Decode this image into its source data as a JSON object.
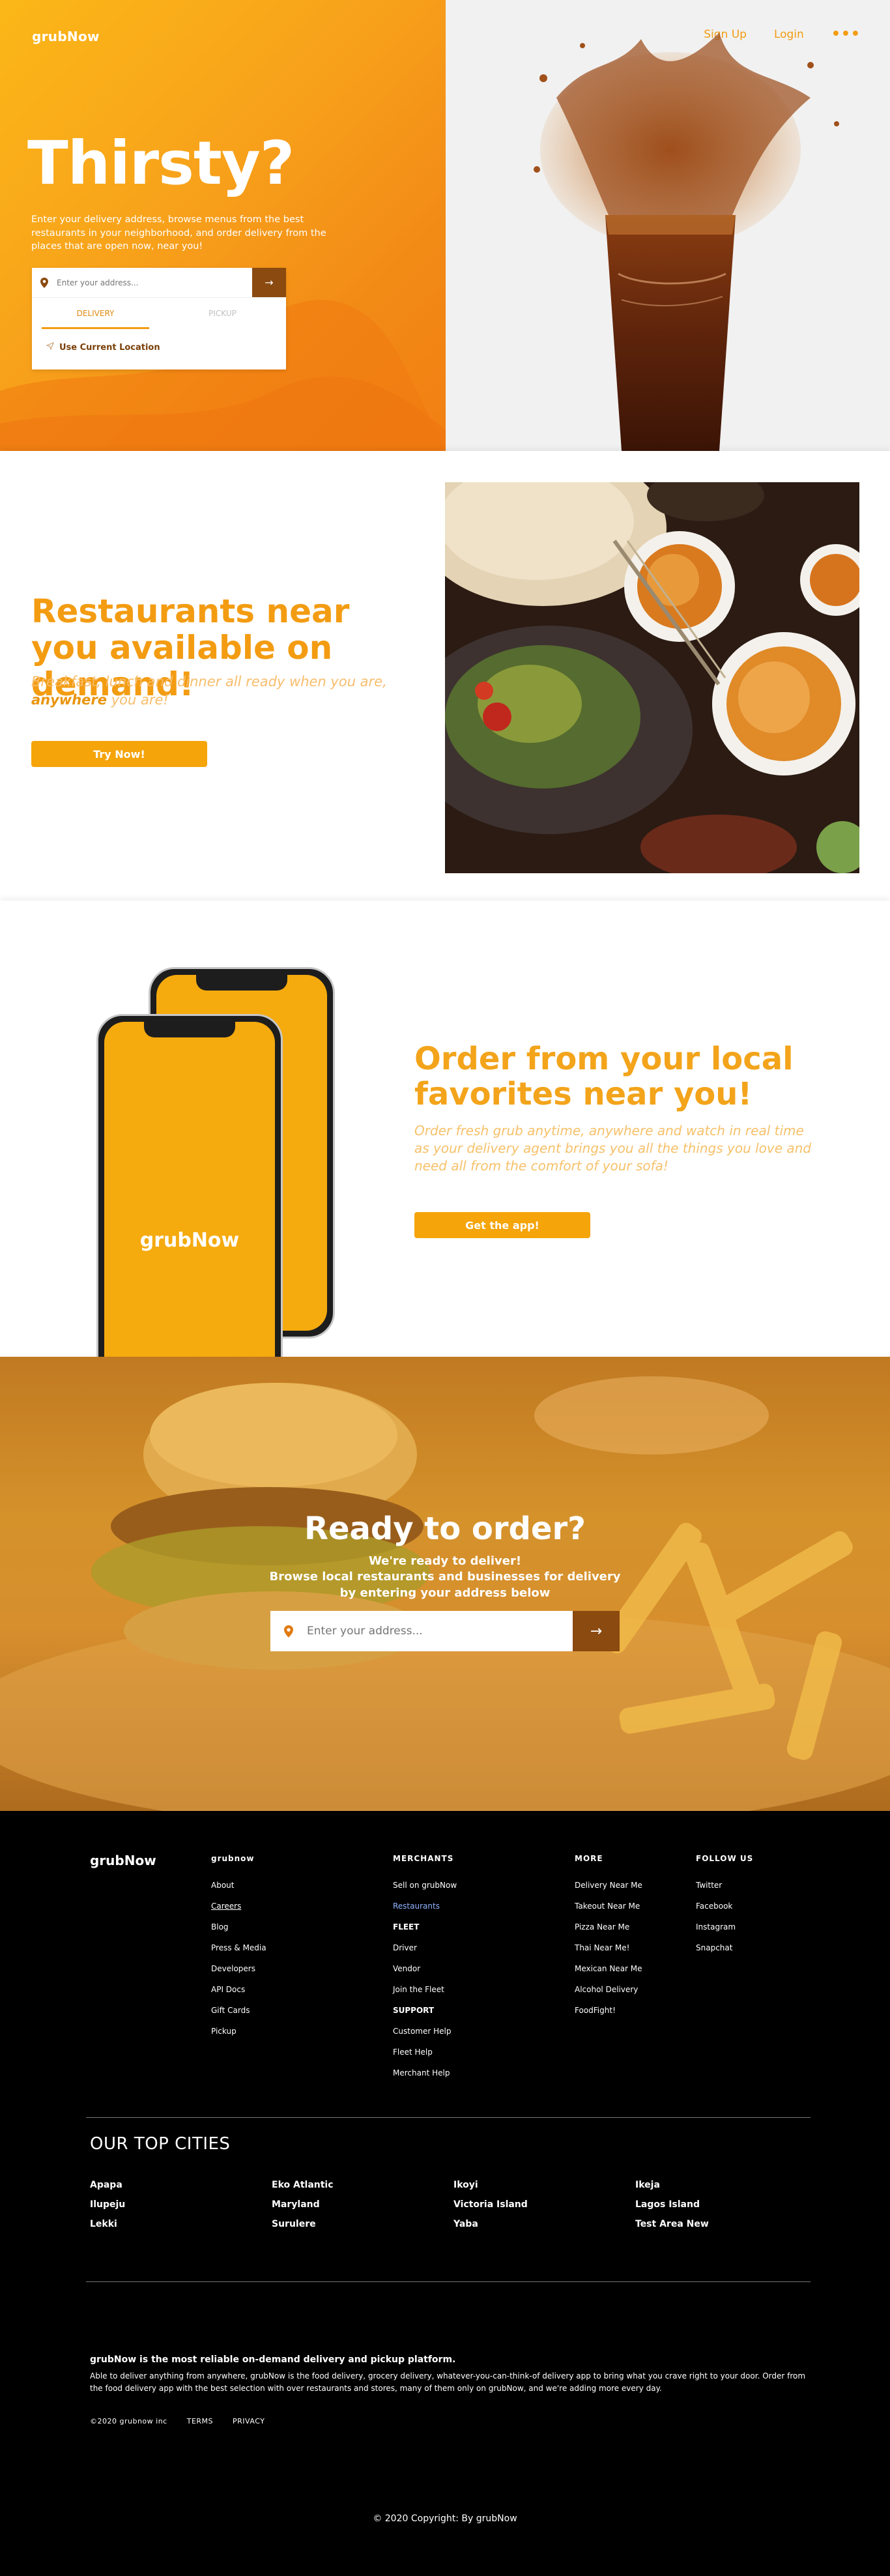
{
  "brand": "grubNow",
  "nav": {
    "signup": "Sign Up",
    "login": "Login",
    "more": "•••"
  },
  "hero": {
    "title": "Thirsty?",
    "lead": "Enter your delivery address, browse menus from the best restaurants in your neighborhood, and order delivery from the places that are open now, near you!",
    "address_placeholder": "Enter your address...",
    "go_arrow": "→",
    "tab_delivery": "DELIVERY",
    "tab_pickup": "PICKUP",
    "use_location": "Use Current Location"
  },
  "restaurants": {
    "title": "Restaurants near you available on demand!",
    "subtitle_pre": "Breakfast, lunch and dinner all ready when you are, ",
    "subtitle_bold": "anywhere",
    "subtitle_post": " you are!",
    "cta": "Try Now!"
  },
  "app": {
    "phone_brand": "grubNow",
    "title": "Order from your local favorites near you!",
    "subtitle": "Order fresh grub anytime, anywhere and watch in real time as your delivery agent brings you all the things you love and need all from the comfort of your sofa!",
    "cta": "Get the app!"
  },
  "ready": {
    "title": "Ready to order?",
    "line1": "We're ready to deliver!",
    "line2": "Browse local restaurants and businesses for delivery",
    "line3": "by entering your address below",
    "placeholder": "Enter your address...",
    "go_arrow": "→"
  },
  "footer": {
    "logo": "grubNow",
    "columns": [
      {
        "heading": "grubnow",
        "items": [
          "About",
          "Careers",
          "Blog",
          "Press & Media",
          "Developers",
          "API Docs",
          "Gift Cards",
          "Pickup"
        ]
      },
      {
        "heading": "MERCHANTS",
        "items": [
          "Sell on grubNow",
          "Restaurants",
          "FLEET",
          "Driver",
          "Vendor",
          "Join the Fleet",
          "SUPPORT",
          "Customer Help",
          "Fleet Help",
          "Merchant Help"
        ]
      },
      {
        "heading": "MORE",
        "items": [
          "Delivery Near Me",
          "Takeout Near Me",
          "Pizza Near Me",
          "Thai Near Me!",
          "Mexican Near Me",
          "Alcohol Delivery",
          "FoodFight!"
        ]
      },
      {
        "heading": "FOLLOW US",
        "items": [
          "Twitter",
          "Facebook",
          "Instagram",
          "Snapchat"
        ]
      }
    ],
    "cities_title": "OUR TOP CITIES",
    "cities": [
      "Apapa",
      "Eko Atlantic",
      "Ikoyi",
      "Ikeja",
      "Ilupeju",
      "Maryland",
      "Victoria Island",
      "Lagos Island",
      "Lekki",
      "Surulere",
      "Yaba",
      "Test Area New"
    ],
    "about_title": "grubNow is the most reliable on-demand delivery and pickup platform.",
    "about_text": "Able to deliver anything from anywhere, grubNow is the food delivery, grocery delivery, whatever-you-can-think-of delivery app to bring what you crave right to your door. Order from the food delivery app with the best selection with over restaurants and stores, many of them only on grubNow, and we're adding more every day.",
    "legal_company": "©2020 grubnow inc",
    "legal_terms": "TERMS",
    "legal_privacy": "PRIVACY",
    "copyright": "© 2020 Copyright: By grubNow"
  }
}
